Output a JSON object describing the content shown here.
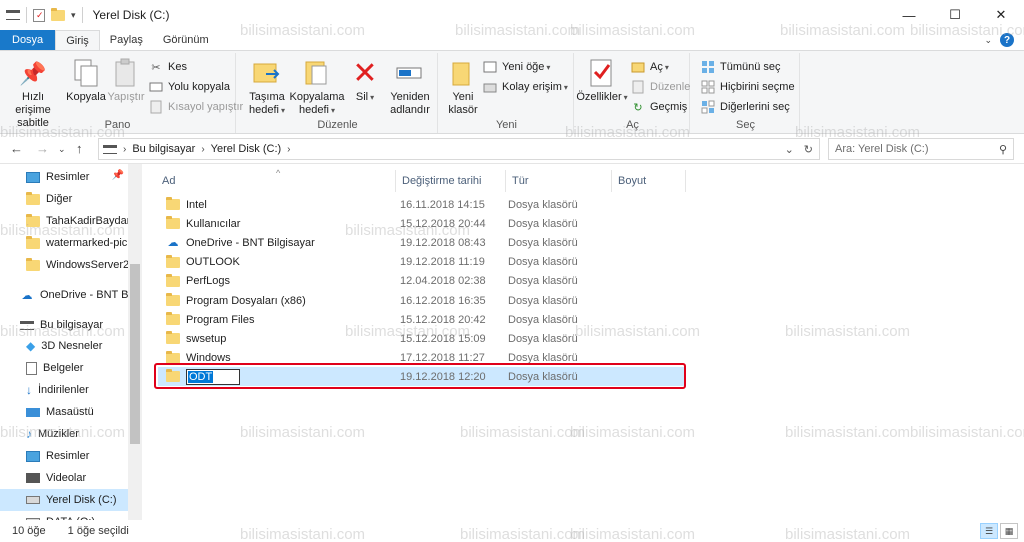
{
  "window": {
    "title": "Yerel Disk (C:)",
    "minimize": "—",
    "maximize": "☐",
    "close": "✕"
  },
  "tabs": [
    "Dosya",
    "Giriş",
    "Paylaş",
    "Görünüm"
  ],
  "ribbon": {
    "pano": {
      "label": "Pano",
      "pin": "Hızlı erişime sabitle",
      "copy": "Kopyala",
      "paste": "Yapıştır",
      "cut": "Kes",
      "copy_path": "Yolu kopyala",
      "paste_shortcut": "Kısayol yapıştır"
    },
    "duzenle": {
      "label": "Düzenle",
      "move_to": "Taşıma hedefi",
      "copy_to": "Kopyalama hedefi",
      "delete": "Sil",
      "rename": "Yeniden adlandır"
    },
    "yeni": {
      "label": "Yeni",
      "new_folder": "Yeni klasör",
      "new_item": "Yeni öğe",
      "easy_access": "Kolay erişim"
    },
    "ac": {
      "label": "Aç",
      "properties": "Özellikler",
      "open": "Aç",
      "edit": "Düzenle",
      "history": "Geçmiş"
    },
    "sec": {
      "label": "Seç",
      "select_all": "Tümünü seç",
      "select_none": "Hiçbirini seçme",
      "invert": "Diğerlerini seç"
    }
  },
  "address": {
    "crumbs": [
      "Bu bilgisayar",
      "Yerel Disk (C:)"
    ],
    "search_placeholder": "Ara: Yerel Disk (C:)"
  },
  "sidebar": [
    {
      "label": "Resimler",
      "icon": "pictures-icon",
      "pinned": true
    },
    {
      "label": "Diğer",
      "icon": "folder-icon"
    },
    {
      "label": "TahaKadirBaydar",
      "icon": "folder-icon"
    },
    {
      "label": "watermarked-pic",
      "icon": "folder-icon"
    },
    {
      "label": "WindowsServer2",
      "icon": "folder-icon"
    },
    {
      "label": "OneDrive - BNT B",
      "icon": "onedrive-icon"
    },
    {
      "label": "Bu bilgisayar",
      "icon": "computer-icon"
    },
    {
      "label": "3D Nesneler",
      "icon": "3d-objects-icon"
    },
    {
      "label": "Belgeler",
      "icon": "documents-icon"
    },
    {
      "label": "İndirilenler",
      "icon": "downloads-icon"
    },
    {
      "label": "Masaüstü",
      "icon": "desktop-icon"
    },
    {
      "label": "Müzikler",
      "icon": "music-icon"
    },
    {
      "label": "Resimler",
      "icon": "pictures-icon"
    },
    {
      "label": "Videolar",
      "icon": "videos-icon"
    },
    {
      "label": "Yerel Disk (C:)",
      "icon": "drive-icon",
      "selected": true
    },
    {
      "label": "DATA (Q:)",
      "icon": "drive-icon"
    }
  ],
  "columns": [
    "Ad",
    "Değiştirme tarihi",
    "Tür",
    "Boyut"
  ],
  "files": [
    {
      "name": "Intel",
      "date": "16.11.2018 14:15",
      "type": "Dosya klasörü",
      "icon": "folder-icon"
    },
    {
      "name": "Kullanıcılar",
      "date": "15.12.2018 20:44",
      "type": "Dosya klasörü",
      "icon": "folder-icon"
    },
    {
      "name": "OneDrive - BNT Bilgisayar",
      "date": "19.12.2018 08:43",
      "type": "Dosya klasörü",
      "icon": "onedrive-icon"
    },
    {
      "name": "OUTLOOK",
      "date": "19.12.2018 11:19",
      "type": "Dosya klasörü",
      "icon": "folder-icon"
    },
    {
      "name": "PerfLogs",
      "date": "12.04.2018 02:38",
      "type": "Dosya klasörü",
      "icon": "folder-icon"
    },
    {
      "name": "Program Dosyaları (x86)",
      "date": "16.12.2018 16:35",
      "type": "Dosya klasörü",
      "icon": "folder-icon"
    },
    {
      "name": "Program Files",
      "date": "15.12.2018 20:42",
      "type": "Dosya klasörü",
      "icon": "folder-icon"
    },
    {
      "name": "swsetup",
      "date": "15.12.2018 15:09",
      "type": "Dosya klasörü",
      "icon": "folder-icon"
    },
    {
      "name": "Windows",
      "date": "17.12.2018 11:27",
      "type": "Dosya klasörü",
      "icon": "folder-icon"
    }
  ],
  "renaming": {
    "name": "ODT",
    "date": "19.12.2018 12:20",
    "type": "Dosya klasörü"
  },
  "status": {
    "count": "10 öğe",
    "selected": "1 öğe seçildi"
  },
  "watermark": "bilisimasistani.com"
}
